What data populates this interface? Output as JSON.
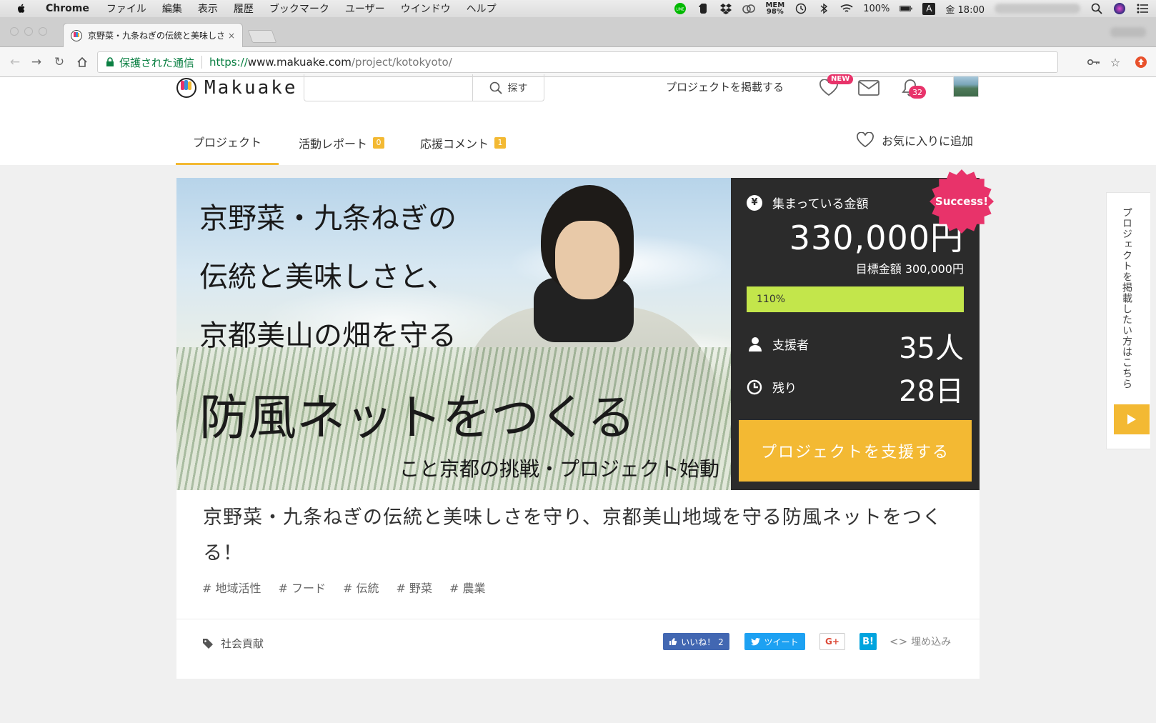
{
  "menubar": {
    "app": "Chrome",
    "items": [
      "ファイル",
      "編集",
      "表示",
      "履歴",
      "ブックマーク",
      "ユーザー",
      "ウインドウ",
      "ヘルプ"
    ],
    "mem_label": "MEM",
    "mem_value": "98%",
    "battery": "100%",
    "input_mode": "A",
    "clock": "金 18:00"
  },
  "browser": {
    "tab_title": "京野菜・九条ねぎの伝統と美味しさ",
    "tab_close": "×",
    "secure_label": "保護された通信",
    "url_scheme": "https://",
    "url_host": "www.makuake.com",
    "url_path": "/project/kotokyoto/"
  },
  "site": {
    "logo_text": "Makuake",
    "search_placeholder": "",
    "search_button": "探す",
    "post_project": "プロジェクトを掲載する",
    "new_badge": "NEW",
    "notification_count": "32"
  },
  "tabs": {
    "project": "プロジェクト",
    "reports": "活動レポート",
    "reports_count": "0",
    "comments": "応援コメント",
    "comments_count": "1",
    "favorite": "お気に入りに追加"
  },
  "hero": {
    "line1": "京野菜・九条ねぎの",
    "line2": "伝統と美味しさと、",
    "line3": "京都美山の畑を守る",
    "line4": "防風ネットをつくる",
    "subline": "こと京都の挑戦・プロジェクト始動"
  },
  "stats": {
    "raised_label": "集まっている金額",
    "raised_amount": "330,000円",
    "goal": "目標金額 300,000円",
    "progress_percent": 110,
    "progress_label": "110%",
    "backers_label": "支援者",
    "backers_value": "35人",
    "remaining_label": "残り",
    "remaining_value": "28日",
    "cta": "プロジェクトを支援する",
    "success_badge": "Success!"
  },
  "project": {
    "title": "京野菜・九条ねぎの伝統と美味しさを守り、京都美山地域を守る防風ネットをつくる！",
    "tags": [
      "# 地域活性",
      "# フード",
      "# 伝統",
      "# 野菜",
      "# 農業"
    ],
    "category": "社会貢献"
  },
  "share": {
    "like": "いいね！ 2",
    "tweet": "ツイート",
    "gplus": "G+",
    "hatena": "B!",
    "embed": "埋め込み"
  },
  "sidetab": {
    "label": "プロジェクトを掲載したい方はこちら"
  },
  "colors": {
    "accent": "#f3b933",
    "panel": "#2b2b2b",
    "progress": "#c3e64b",
    "badge": "#e8336a"
  }
}
